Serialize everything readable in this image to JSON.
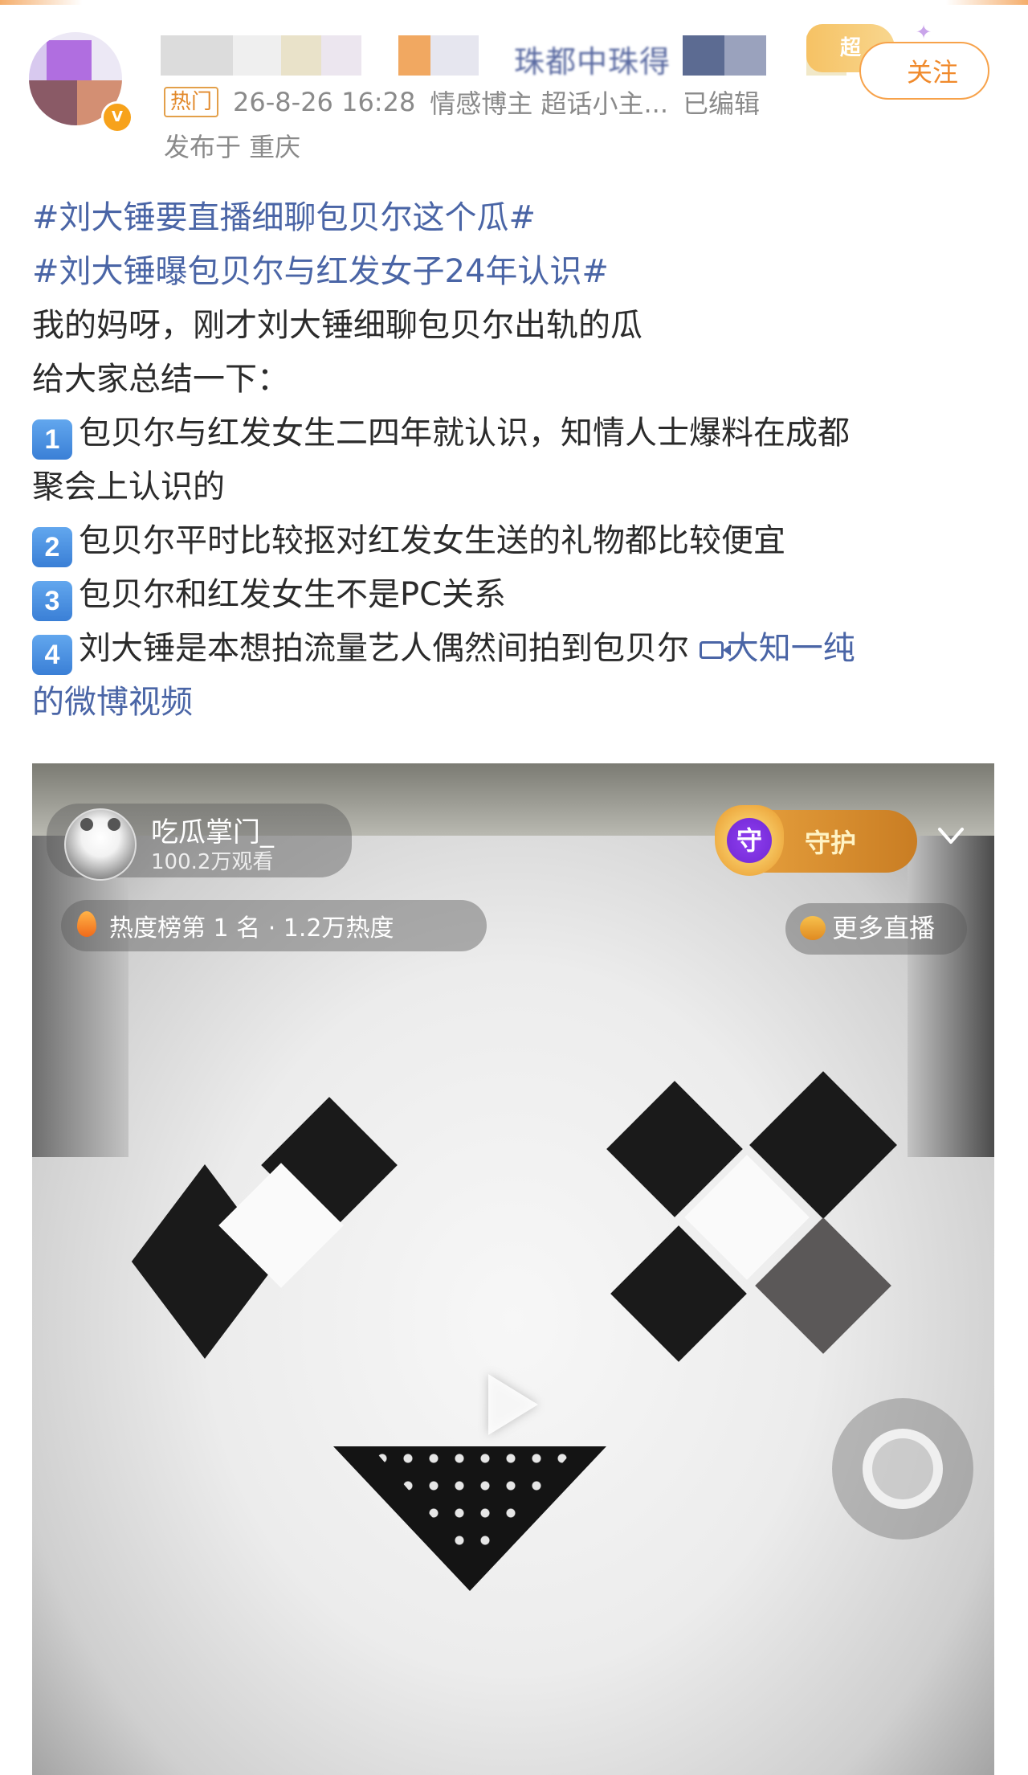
{
  "post_header": {
    "hot_label": "热门",
    "timestamp": "26-8-26 16:28",
    "author_tags": "情感博主 超话小主...",
    "edited_label": "已编辑",
    "location": "发布于 重庆",
    "follow_label": "关注",
    "nickname_partial": "珠都中珠得"
  },
  "post_body": {
    "topics": [
      "#刘大锤要直播细聊包贝尔这个瓜#",
      "#刘大锤曝包贝尔与红发女子24年认识#"
    ],
    "intro_lines": [
      "我的妈呀，刚才刘大锤细聊包贝尔出轨的瓜",
      "给大家总结一下："
    ],
    "points": [
      {
        "num": "1",
        "text": "包贝尔与红发女生二四年就认识，知情人士爆料在成都",
        "text_cont": "聚会上认识的"
      },
      {
        "num": "2",
        "text": "包贝尔平时比较抠对红发女生送的礼物都比较便宜"
      },
      {
        "num": "3",
        "text": "包贝尔和红发女生不是PC关系"
      },
      {
        "num": "4",
        "text": "刘大锤是本想拍流量艺人偶然间拍到包贝尔 "
      }
    ],
    "video_link_a": "大知一纯",
    "video_link_b": "的微博视频"
  },
  "video": {
    "streamer_name": "吃瓜掌门_",
    "streamer_views": "100.2万观看",
    "heat_rank": "热度榜第 1 名 · 1.2万热度",
    "guard_icon_text": "守",
    "guard_label": "守护",
    "more_live": "更多直播"
  },
  "icons": {
    "play": "play-icon",
    "collapse": "chevron-down-icon",
    "fire": "fire-icon",
    "assistive": "assistive-touch-icon"
  },
  "colors": {
    "topic_link": "#4a65a6",
    "follow_accent": "#f08a2c",
    "meta_text": "#8a8a8a"
  }
}
